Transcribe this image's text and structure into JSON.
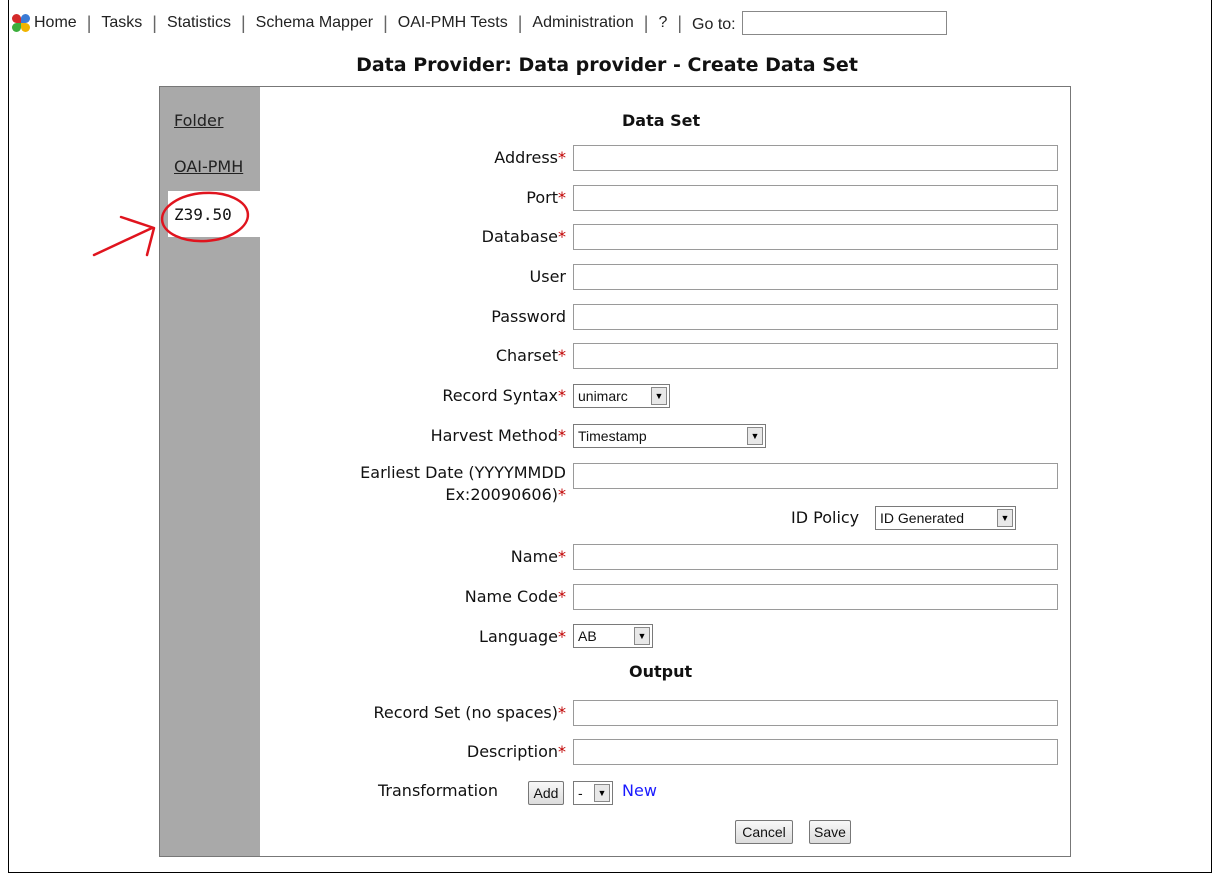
{
  "nav": {
    "home": "Home",
    "tasks": "Tasks",
    "statistics": "Statistics",
    "schema_mapper": "Schema Mapper",
    "oai_pmh_tests": "OAI-PMH Tests",
    "administration": "Administration",
    "help": "?",
    "goto_label": "Go to:",
    "goto_value": ""
  },
  "page_title": "Data Provider: Data provider - Create Data Set",
  "tabs": [
    {
      "label": "Folder"
    },
    {
      "label": "OAI-PMH"
    },
    {
      "label": "Z39.50",
      "active": true
    }
  ],
  "form": {
    "section_data_set": "Data Set",
    "section_output": "Output",
    "address": "Address",
    "port": "Port",
    "database": "Database",
    "user": "User",
    "password": "Password",
    "charset": "Charset",
    "record_syntax": "Record Syntax",
    "record_syntax_value": "unimarc",
    "harvest_method": "Harvest Method",
    "harvest_method_value": "Timestamp",
    "earliest_date_line1": "Earliest Date (YYYYMMDD",
    "earliest_date_line2": "Ex:20090606)",
    "id_policy": "ID Policy",
    "id_policy_value": "ID Generated",
    "name": "Name",
    "name_code": "Name Code",
    "language": "Language",
    "language_value": "AB",
    "record_set": "Record Set (no spaces)",
    "description": "Description",
    "transformation": "Transformation",
    "add_button": "Add",
    "transformation_value": "-",
    "new_link": "New",
    "cancel_button": "Cancel",
    "save_button": "Save",
    "required_marker": "*"
  },
  "colors": {
    "required": "#c00000",
    "sidebar": "#a9a9a9",
    "annotation": "#e0141e",
    "link": "#1a1aff"
  }
}
